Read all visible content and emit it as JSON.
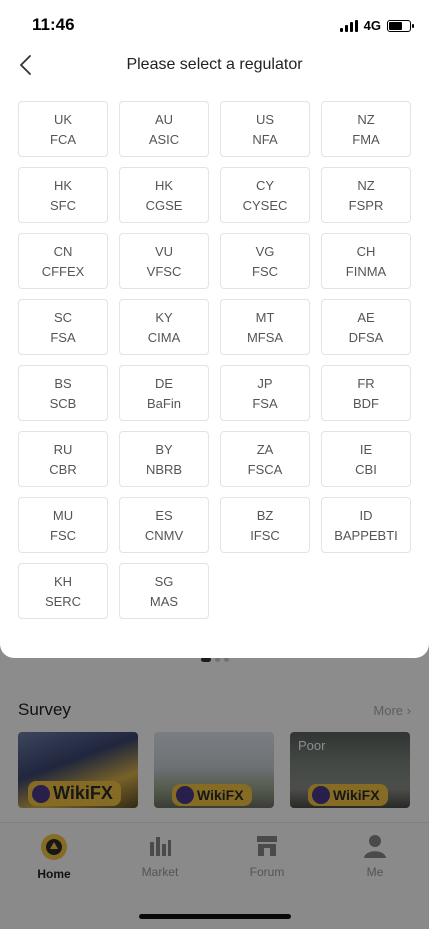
{
  "status_bar": {
    "time": "11:46",
    "network": "4G"
  },
  "header": {
    "title": "Please select a regulator"
  },
  "regulators": [
    {
      "country": "UK",
      "agency": "FCA"
    },
    {
      "country": "AU",
      "agency": "ASIC"
    },
    {
      "country": "US",
      "agency": "NFA"
    },
    {
      "country": "NZ",
      "agency": "FMA"
    },
    {
      "country": "HK",
      "agency": "SFC"
    },
    {
      "country": "HK",
      "agency": "CGSE"
    },
    {
      "country": "CY",
      "agency": "CYSEC"
    },
    {
      "country": "NZ",
      "agency": "FSPR"
    },
    {
      "country": "CN",
      "agency": "CFFEX"
    },
    {
      "country": "VU",
      "agency": "VFSC"
    },
    {
      "country": "VG",
      "agency": "FSC"
    },
    {
      "country": "CH",
      "agency": "FINMA"
    },
    {
      "country": "SC",
      "agency": "FSA"
    },
    {
      "country": "KY",
      "agency": "CIMA"
    },
    {
      "country": "MT",
      "agency": "MFSA"
    },
    {
      "country": "AE",
      "agency": "DFSA"
    },
    {
      "country": "BS",
      "agency": "SCB"
    },
    {
      "country": "DE",
      "agency": "BaFin"
    },
    {
      "country": "JP",
      "agency": "FSA"
    },
    {
      "country": "FR",
      "agency": "BDF"
    },
    {
      "country": "RU",
      "agency": "CBR"
    },
    {
      "country": "BY",
      "agency": "NBRB"
    },
    {
      "country": "ZA",
      "agency": "FSCA"
    },
    {
      "country": "IE",
      "agency": "CBI"
    },
    {
      "country": "MU",
      "agency": "FSC"
    },
    {
      "country": "ES",
      "agency": "CNMV"
    },
    {
      "country": "BZ",
      "agency": "IFSC"
    },
    {
      "country": "ID",
      "agency": "BAPPEBTI"
    },
    {
      "country": "KH",
      "agency": "SERC"
    },
    {
      "country": "SG",
      "agency": "MAS"
    }
  ],
  "background": {
    "survey_title": "Survey",
    "more_label": "More",
    "thumb_badge": "WikiFX",
    "poor_tag": "Poor"
  },
  "tabbar": {
    "items": [
      {
        "label": "Home",
        "icon": "home-logo-icon"
      },
      {
        "label": "Market",
        "icon": "bar-chart-icon"
      },
      {
        "label": "Forum",
        "icon": "store-icon"
      },
      {
        "label": "Me",
        "icon": "person-icon"
      }
    ]
  },
  "colors": {
    "accent": "#f2c440",
    "brand_dark": "#4a3a8c"
  }
}
